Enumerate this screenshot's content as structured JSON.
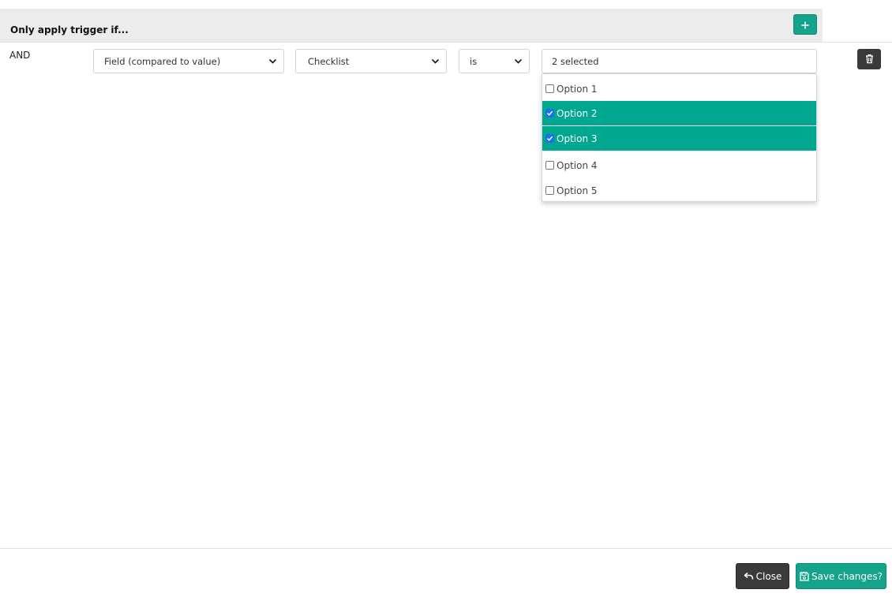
{
  "header": {
    "title": "Only apply trigger if...",
    "add_icon": "plus-icon"
  },
  "condition": {
    "connector": "AND",
    "type_select": "Field (compared to value)",
    "field_select": "Checklist",
    "operator_select": "is",
    "value_summary": "2 selected",
    "delete_icon": "trash-icon"
  },
  "options": [
    {
      "label": "Option 1",
      "checked": false
    },
    {
      "label": "Option 2",
      "checked": true
    },
    {
      "label": "Option 3",
      "checked": true
    },
    {
      "label": "Option 4",
      "checked": false
    },
    {
      "label": "Option 5",
      "checked": false
    }
  ],
  "footer": {
    "close_label": "Close",
    "save_label": "Save changes?"
  },
  "colors": {
    "accent": "#14a38b",
    "selected_option": "#00a88f",
    "dark_button": "#3a3a3a"
  }
}
